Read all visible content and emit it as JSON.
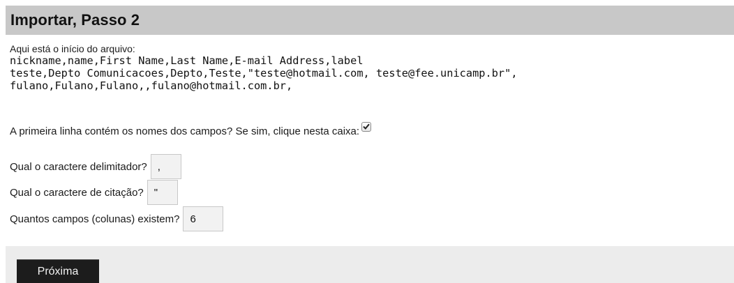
{
  "page": {
    "title": "Importar, Passo 2"
  },
  "preview": {
    "intro": "Aqui está o início do arquivo:",
    "lines": [
      "nickname,name,First Name,Last Name,E-mail Address,label",
      "teste,Depto Comunicacoes,Depto,Teste,\"teste@hotmail.com, teste@fee.unicamp.br\",",
      "fulano,Fulano,Fulano,,fulano@hotmail.com.br,"
    ]
  },
  "form": {
    "header_label": "A primeira linha contém os nomes dos campos? Se sim, clique nesta caixa:",
    "header_checked": true,
    "delimiter_label": "Qual o caractere delimitador?",
    "delimiter_value": ",",
    "quote_label": "Qual o caractere de citação?",
    "quote_value": "\"",
    "fields_label": "Quantos campos (colunas) existem?",
    "fields_value": "6"
  },
  "footer": {
    "next_label": "Próxima"
  }
}
